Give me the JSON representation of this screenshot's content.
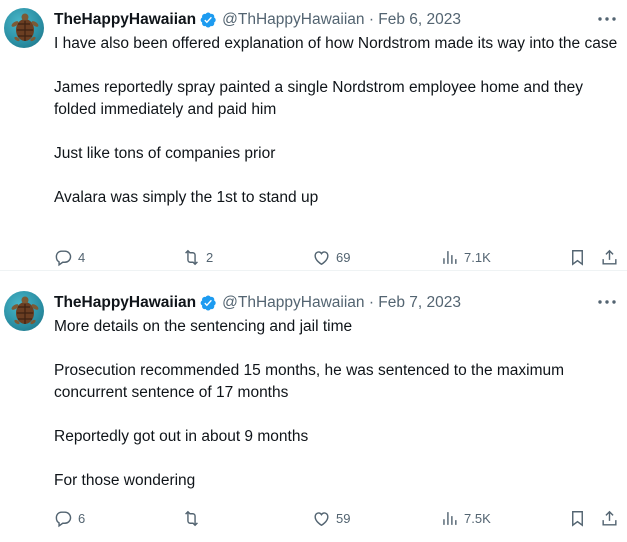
{
  "tweets": [
    {
      "name": "TheHappyHawaiian",
      "handle": "@ThHappyHawaiian",
      "separator": " · ",
      "date": "Feb 6, 2023",
      "paragraphs": [
        "I have also been offered explanation of how Nordstrom made its way into the case",
        "James reportedly spray painted a single Nordstrom employee home and they folded immediately and paid him",
        "Just like tons of companies prior",
        "Avalara was simply the 1st to stand up"
      ],
      "replies": "4",
      "retweets": "2",
      "likes": "69",
      "views": "7.1K"
    },
    {
      "name": "TheHappyHawaiian",
      "handle": "@ThHappyHawaiian",
      "separator": " · ",
      "date": "Feb 7, 2023",
      "paragraphs": [
        "More details on the sentencing and jail time",
        "Prosecution recommended 15 months, he was sentenced to the maximum concurrent sentence of 17 months",
        "Reportedly got out in about 9 months",
        "For those wondering"
      ],
      "replies": "6",
      "retweets": "",
      "likes": "59",
      "views": "7.5K"
    }
  ],
  "colors": {
    "accent": "#1d9bf0",
    "secondary_text": "#536471",
    "primary_text": "#0f1419"
  },
  "icons": [
    "verified-badge-icon",
    "more-icon",
    "reply-icon",
    "retweet-icon",
    "like-icon",
    "views-icon",
    "bookmark-icon",
    "share-icon"
  ]
}
